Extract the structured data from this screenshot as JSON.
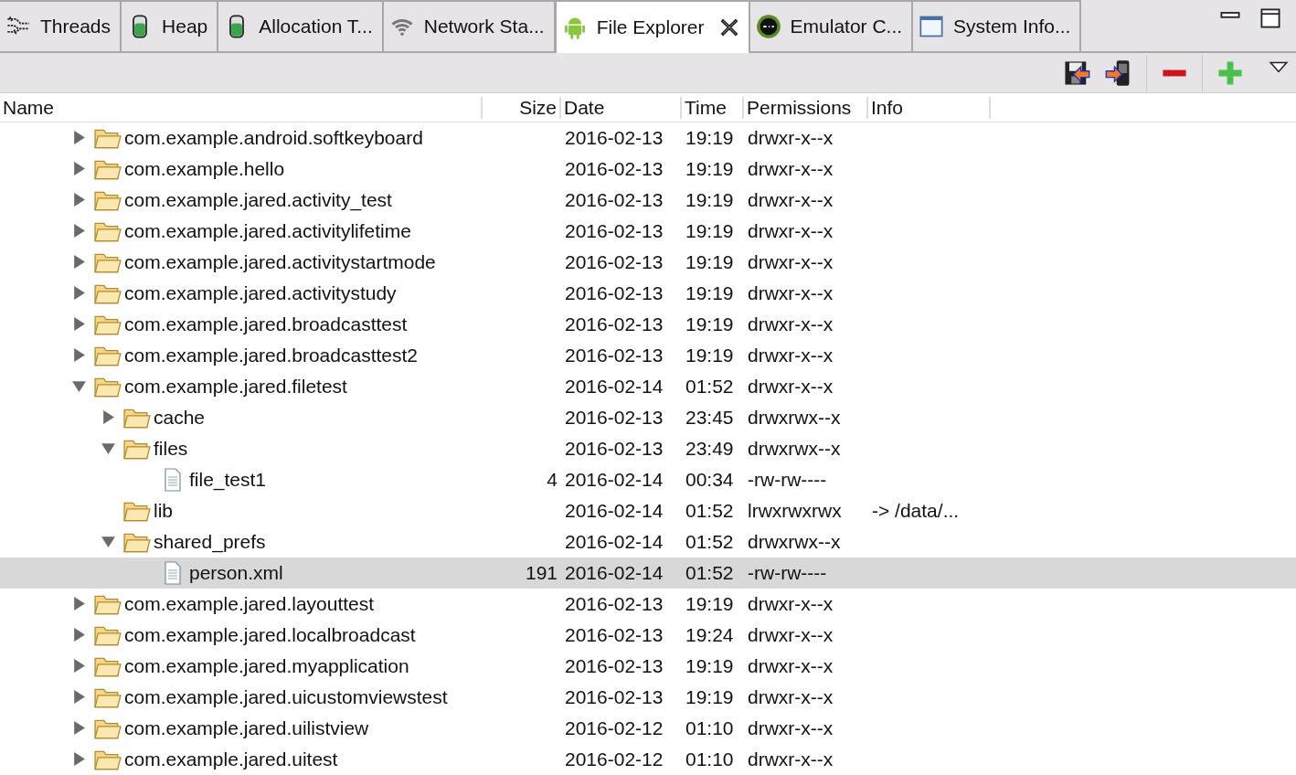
{
  "tabs": [
    {
      "label": "Threads",
      "kind": "threads",
      "selected": false
    },
    {
      "label": "Heap",
      "kind": "heap",
      "selected": false
    },
    {
      "label": "Allocation T...",
      "kind": "heap",
      "selected": false
    },
    {
      "label": "Network Sta...",
      "kind": "network",
      "selected": false
    },
    {
      "label": "File Explorer",
      "kind": "android",
      "selected": true
    },
    {
      "label": "Emulator C...",
      "kind": "emulator",
      "selected": false
    },
    {
      "label": "System Info...",
      "kind": "window",
      "selected": false
    }
  ],
  "table": {
    "columns": [
      "Name",
      "Size",
      "Date",
      "Time",
      "Permissions",
      "Info"
    ],
    "rows": [
      {
        "name": "com.example.android.softkeyboard",
        "kind": "folder",
        "expanded": false,
        "selected": false,
        "date": "2016-02-13",
        "time": "19:19",
        "permissions": "drwxr-x--x"
      },
      {
        "name": "com.example.hello",
        "kind": "folder",
        "expanded": false,
        "selected": false,
        "date": "2016-02-13",
        "time": "19:19",
        "permissions": "drwxr-x--x"
      },
      {
        "name": "com.example.jared.activity_test",
        "kind": "folder",
        "expanded": false,
        "selected": false,
        "date": "2016-02-13",
        "time": "19:19",
        "permissions": "drwxr-x--x"
      },
      {
        "name": "com.example.jared.activitylifetime",
        "kind": "folder",
        "expanded": false,
        "selected": false,
        "date": "2016-02-13",
        "time": "19:19",
        "permissions": "drwxr-x--x"
      },
      {
        "name": "com.example.jared.activitystartmode",
        "kind": "folder",
        "expanded": false,
        "selected": false,
        "date": "2016-02-13",
        "time": "19:19",
        "permissions": "drwxr-x--x"
      },
      {
        "name": "com.example.jared.activitystudy",
        "kind": "folder",
        "expanded": false,
        "selected": false,
        "date": "2016-02-13",
        "time": "19:19",
        "permissions": "drwxr-x--x"
      },
      {
        "name": "com.example.jared.broadcasttest",
        "kind": "folder",
        "expanded": false,
        "selected": false,
        "date": "2016-02-13",
        "time": "19:19",
        "permissions": "drwxr-x--x"
      },
      {
        "name": "com.example.jared.broadcasttest2",
        "kind": "folder",
        "expanded": false,
        "selected": false,
        "date": "2016-02-13",
        "time": "19:19",
        "permissions": "drwxr-x--x"
      },
      {
        "name": "com.example.jared.filetest",
        "kind": "folder",
        "expanded": true,
        "selected": false,
        "date": "2016-02-14",
        "time": "01:52",
        "permissions": "drwxr-x--x",
        "children": [
          {
            "name": "cache",
            "kind": "folder",
            "expanded": false,
            "selected": false,
            "date": "2016-02-13",
            "time": "23:45",
            "permissions": "drwxrwx--x"
          },
          {
            "name": "files",
            "kind": "folder",
            "expanded": true,
            "selected": false,
            "date": "2016-02-13",
            "time": "23:49",
            "permissions": "drwxrwx--x",
            "children": [
              {
                "name": "file_test1",
                "kind": "file",
                "selected": false,
                "size": "4",
                "date": "2016-02-14",
                "time": "00:34",
                "permissions": "-rw-rw----"
              }
            ]
          },
          {
            "name": "lib",
            "kind": "link",
            "selected": false,
            "date": "2016-02-14",
            "time": "01:52",
            "permissions": "lrwxrwxrwx",
            "info": "-> /data/..."
          },
          {
            "name": "shared_prefs",
            "kind": "folder",
            "expanded": true,
            "selected": false,
            "date": "2016-02-14",
            "time": "01:52",
            "permissions": "drwxrwx--x",
            "children": [
              {
                "name": "person.xml",
                "kind": "file",
                "selected": true,
                "size": "191",
                "date": "2016-02-14",
                "time": "01:52",
                "permissions": "-rw-rw----"
              }
            ]
          }
        ]
      },
      {
        "name": "com.example.jared.layouttest",
        "kind": "folder",
        "expanded": false,
        "selected": false,
        "date": "2016-02-13",
        "time": "19:19",
        "permissions": "drwxr-x--x"
      },
      {
        "name": "com.example.jared.localbroadcast",
        "kind": "folder",
        "expanded": false,
        "selected": false,
        "date": "2016-02-13",
        "time": "19:24",
        "permissions": "drwxr-x--x"
      },
      {
        "name": "com.example.jared.myapplication",
        "kind": "folder",
        "expanded": false,
        "selected": false,
        "date": "2016-02-13",
        "time": "19:19",
        "permissions": "drwxr-x--x"
      },
      {
        "name": "com.example.jared.uicustomviewstest",
        "kind": "folder",
        "expanded": false,
        "selected": false,
        "date": "2016-02-13",
        "time": "19:19",
        "permissions": "drwxr-x--x"
      },
      {
        "name": "com.example.jared.uilistview",
        "kind": "folder",
        "expanded": false,
        "selected": false,
        "date": "2016-02-12",
        "time": "01:10",
        "permissions": "drwxr-x--x"
      },
      {
        "name": "com.example.jared.uitest",
        "kind": "folder",
        "expanded": false,
        "selected": false,
        "date": "2016-02-12",
        "time": "01:10",
        "permissions": "drwxr-x--x"
      }
    ]
  }
}
